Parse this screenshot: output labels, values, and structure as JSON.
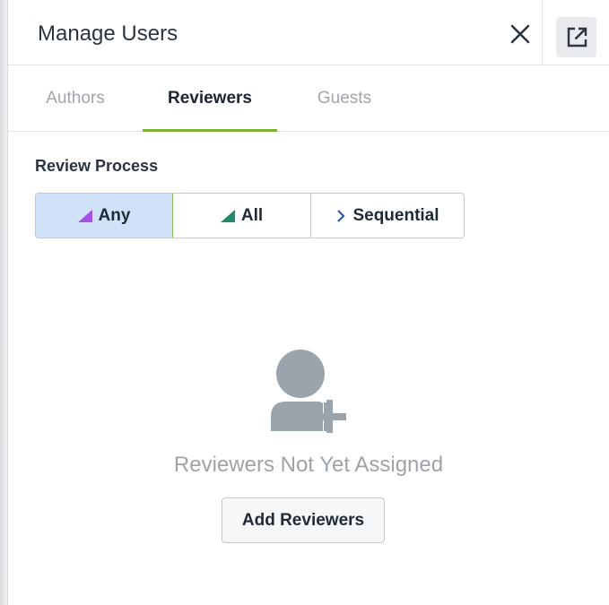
{
  "header": {
    "title": "Manage Users"
  },
  "tabs": [
    {
      "label": "Authors",
      "active": false
    },
    {
      "label": "Reviewers",
      "active": true
    },
    {
      "label": "Guests",
      "active": false
    }
  ],
  "review_process": {
    "label": "Review Process",
    "options": [
      {
        "label": "Any",
        "icon": "triangle-icon",
        "icon_color": "#a64ee6",
        "selected": true
      },
      {
        "label": "All",
        "icon": "triangle-icon",
        "icon_color": "#1f8a6c",
        "selected": false
      },
      {
        "label": "Sequential",
        "icon": "chevron-right-icon",
        "icon_color": "#2a5ba8",
        "selected": false
      }
    ]
  },
  "empty_state": {
    "icon": "add-user-icon",
    "message": "Reviewers Not Yet Assigned",
    "button_label": "Add Reviewers"
  },
  "colors": {
    "accent": "#7cb135",
    "selected_bg": "#cfe2f7",
    "muted_icon": "#9ba3ab"
  }
}
